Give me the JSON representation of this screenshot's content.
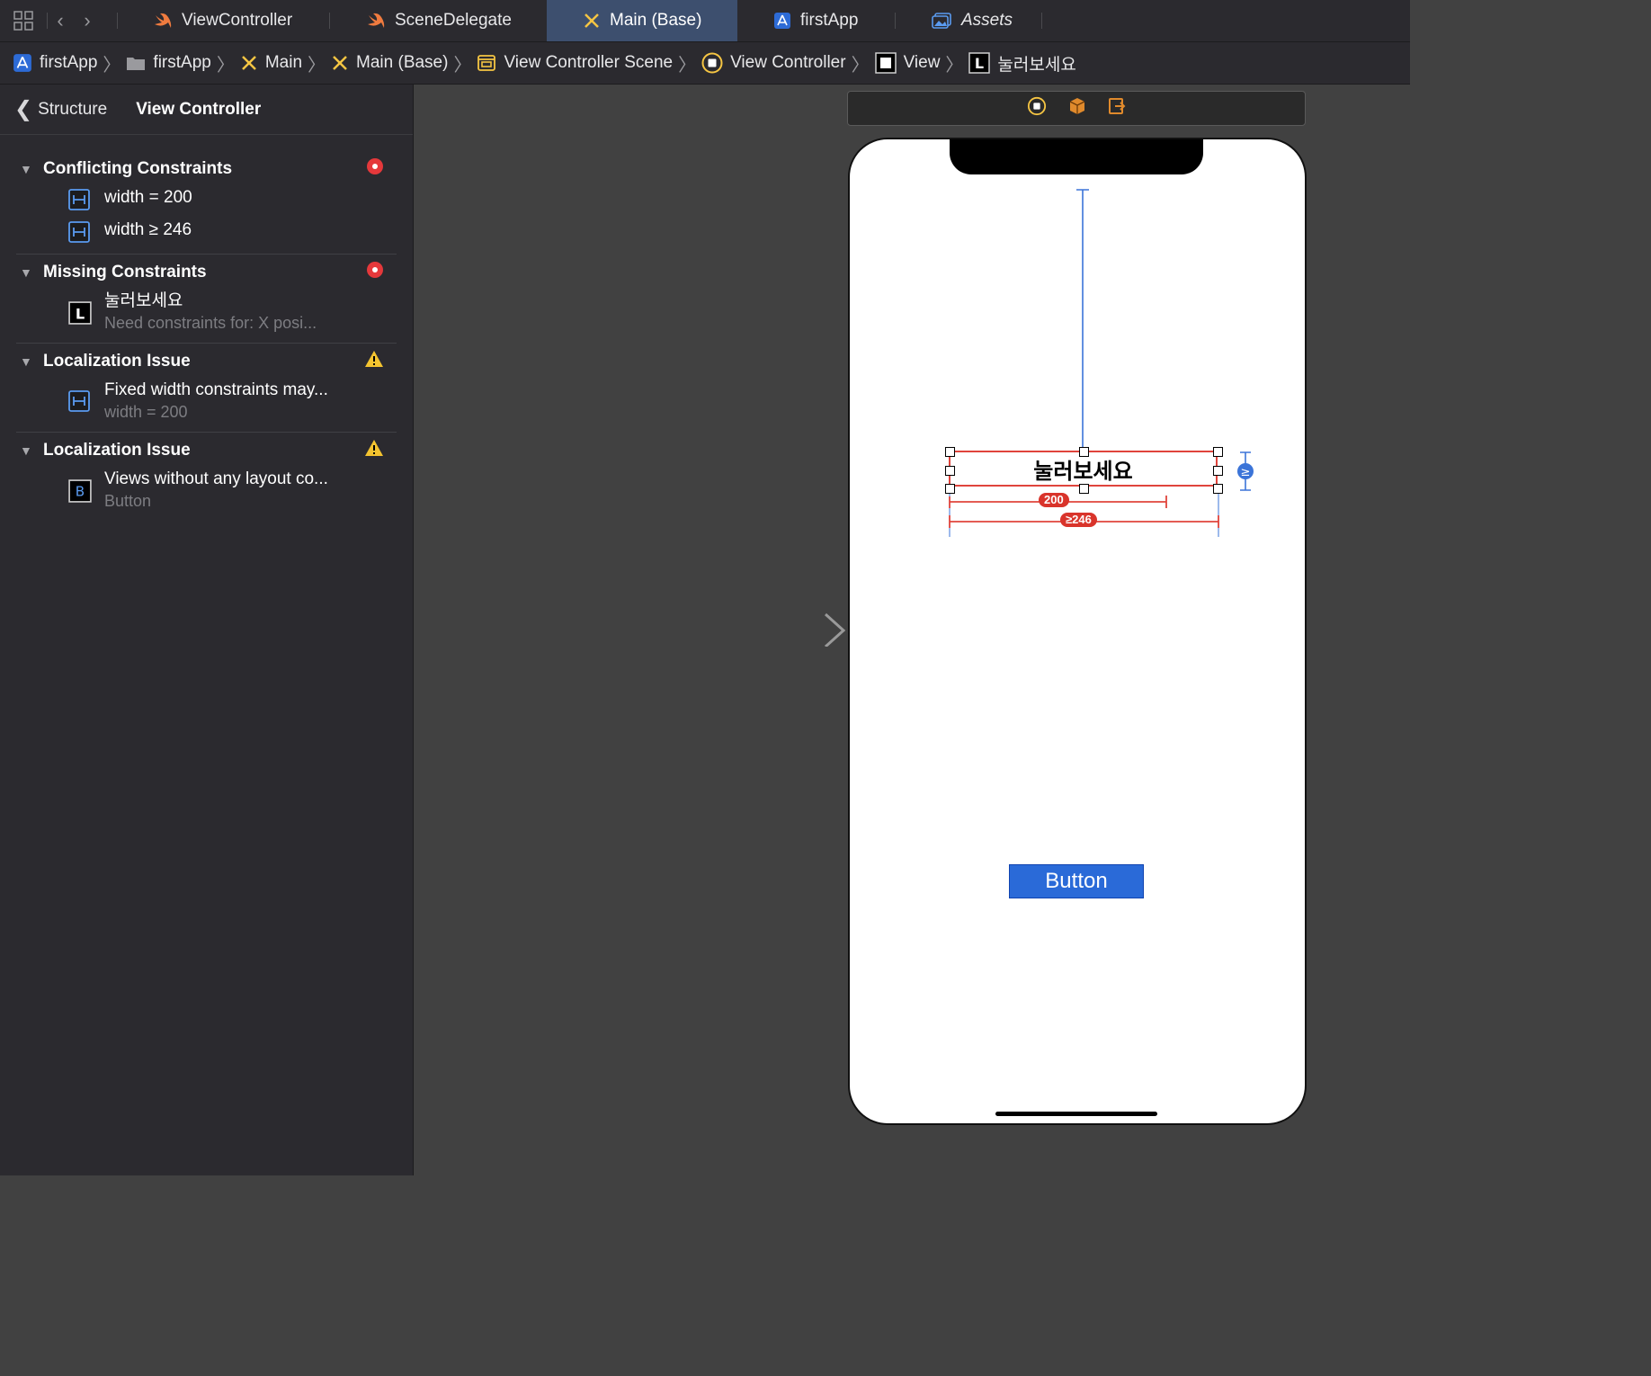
{
  "tabs": [
    {
      "label": "ViewController",
      "icon": "swift-icon"
    },
    {
      "label": "SceneDelegate",
      "icon": "swift-icon"
    },
    {
      "label": "Main (Base)",
      "icon": "storyboard-icon",
      "active": true
    },
    {
      "label": "firstApp",
      "icon": "app-project-icon"
    },
    {
      "label": "Assets",
      "icon": "assets-icon"
    }
  ],
  "breadcrumb": [
    {
      "label": "firstApp",
      "icon": "app-project-icon"
    },
    {
      "label": "firstApp",
      "icon": "folder-icon"
    },
    {
      "label": "Main",
      "icon": "storyboard-icon"
    },
    {
      "label": "Main (Base)",
      "icon": "storyboard-icon"
    },
    {
      "label": "View Controller Scene",
      "icon": "scene-icon"
    },
    {
      "label": "View Controller",
      "icon": "view-controller-icon"
    },
    {
      "label": "View",
      "icon": "view-icon"
    },
    {
      "label": "눌러보세요",
      "icon": "label-icon"
    }
  ],
  "panel": {
    "back_label": "Structure",
    "title": "View Controller",
    "sections": [
      {
        "title": "Conflicting Constraints",
        "badge": "error",
        "items": [
          {
            "text": "width = 200",
            "icon": "constraint-icon"
          },
          {
            "text": "width ≥ 246",
            "icon": "constraint-icon"
          }
        ]
      },
      {
        "title": "Missing Constraints",
        "badge": "error",
        "items": [
          {
            "text": "눌러보세요",
            "sub": "Need constraints for: X posi...",
            "icon": "label-icon"
          }
        ]
      },
      {
        "title": "Localization Issue",
        "badge": "warning",
        "items": [
          {
            "text": "Fixed width constraints may...",
            "sub": "width = 200",
            "icon": "constraint-icon"
          }
        ]
      },
      {
        "title": "Localization Issue",
        "badge": "warning",
        "items": [
          {
            "text": "Views without any layout co...",
            "sub": "Button",
            "icon": "button-icon"
          }
        ]
      }
    ]
  },
  "canvas": {
    "label_text": "눌러보세요",
    "constraint_200": "200",
    "constraint_246": "≥246",
    "button_text": "Button",
    "colors": {
      "constraint": "#e0443c",
      "guide": "#3b74d8",
      "button": "#2a6ad8"
    }
  }
}
